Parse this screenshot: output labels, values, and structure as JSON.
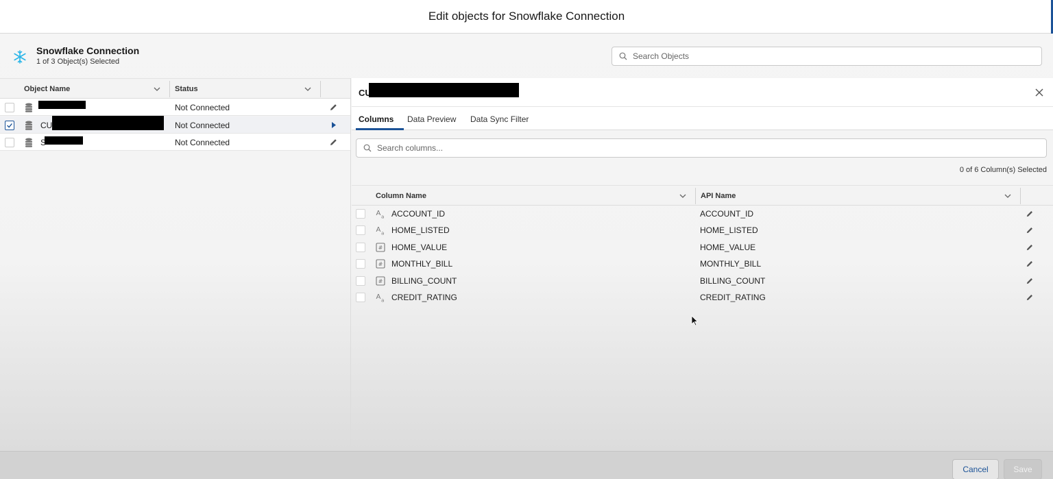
{
  "modal": {
    "title": "Edit objects for Snowflake Connection"
  },
  "connection": {
    "name": "Snowflake Connection",
    "selected_summary": "1 of 3 Object(s) Selected",
    "search_placeholder": "Search Objects"
  },
  "objects_table": {
    "headers": [
      "Object Name",
      "Status"
    ],
    "rows": [
      {
        "name": "",
        "status": "Not Connected",
        "checked": false,
        "selected": false
      },
      {
        "name": "CU",
        "status": "Not Connected",
        "checked": true,
        "selected": true
      },
      {
        "name": "S",
        "status": "Not Connected",
        "checked": false,
        "selected": false
      }
    ]
  },
  "detail": {
    "title": "CU",
    "tabs": [
      "Columns",
      "Data Preview",
      "Data Sync Filter"
    ],
    "active_tab": "Columns",
    "search_placeholder": "Search columns...",
    "selected_summary": "0 of 6 Column(s) Selected",
    "headers": [
      "Column Name",
      "API Name"
    ],
    "columns": [
      {
        "type": "text",
        "name": "ACCOUNT_ID",
        "api": "ACCOUNT_ID"
      },
      {
        "type": "text",
        "name": "HOME_LISTED",
        "api": "HOME_LISTED"
      },
      {
        "type": "number",
        "name": "HOME_VALUE",
        "api": "HOME_VALUE"
      },
      {
        "type": "number",
        "name": "MONTHLY_BILL",
        "api": "MONTHLY_BILL"
      },
      {
        "type": "number",
        "name": "BILLING_COUNT",
        "api": "BILLING_COUNT"
      },
      {
        "type": "text",
        "name": "CREDIT_RATING",
        "api": "CREDIT_RATING"
      }
    ]
  },
  "footer": {
    "cancel_label": "Cancel",
    "save_label": "Save"
  },
  "colors": {
    "brand": "#1b5297",
    "snowflake": "#29b5e8"
  }
}
